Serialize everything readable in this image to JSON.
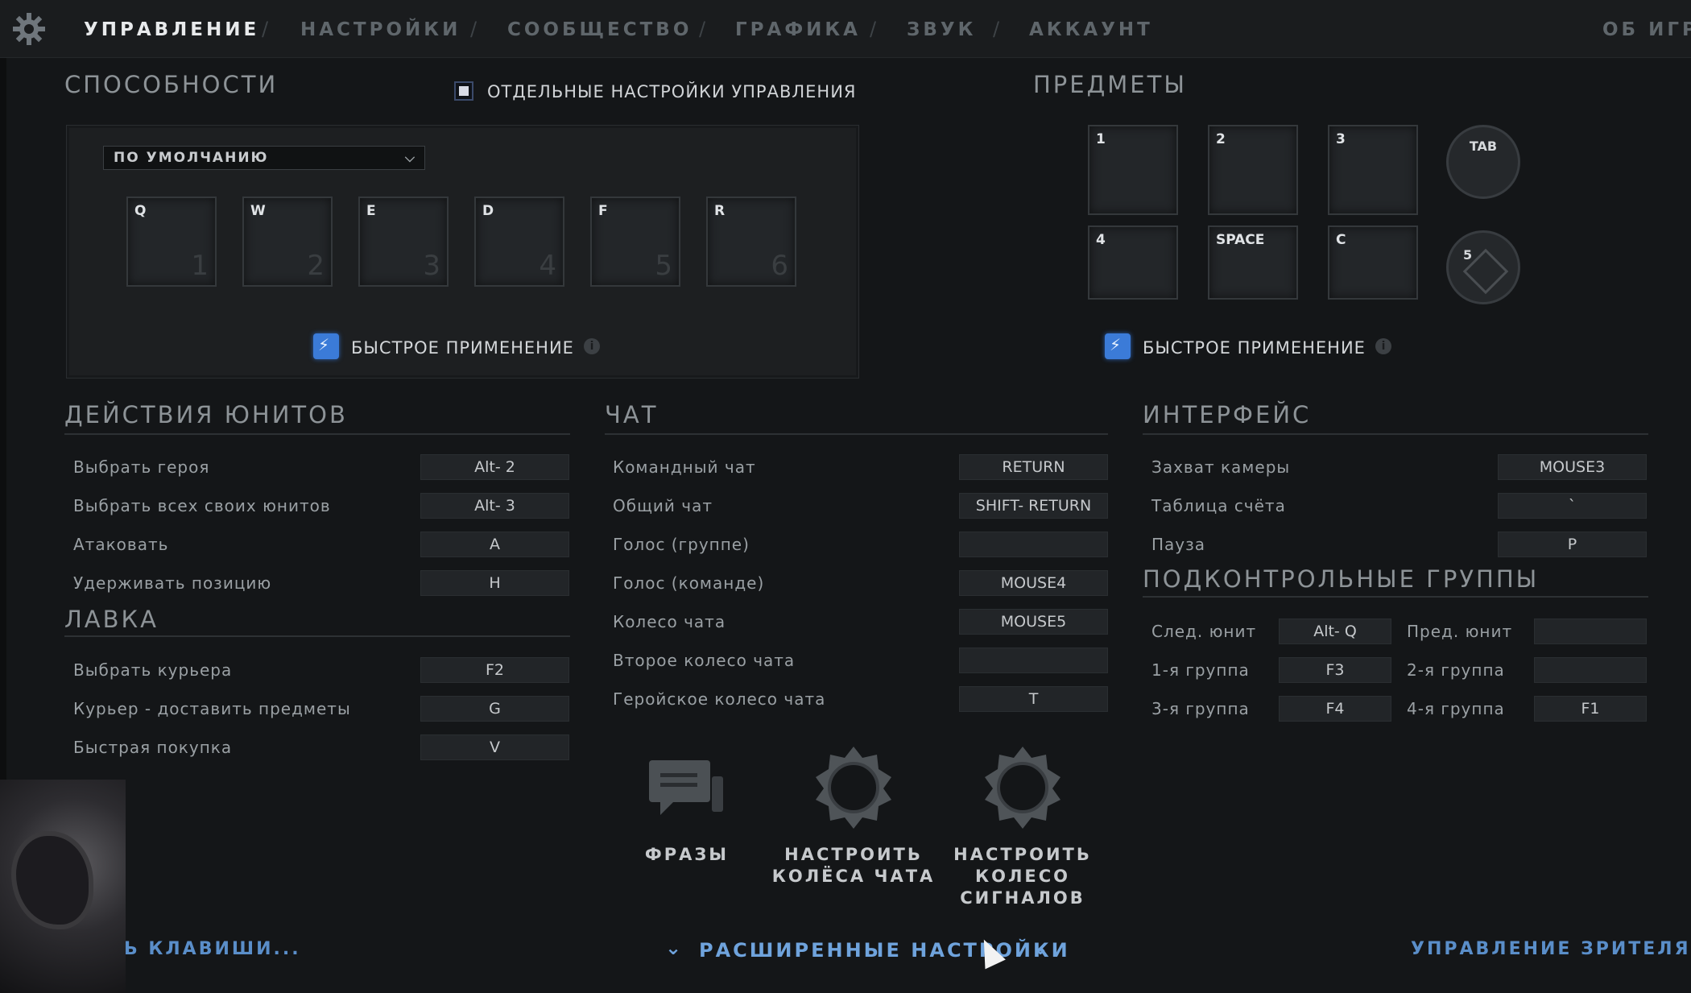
{
  "nav": {
    "tabs": [
      "УПРАВЛЕНИЕ",
      "НАСТРОЙКИ",
      "СООБЩЕСТВО",
      "ГРАФИКА",
      "ЗВУК",
      "АККАУНТ",
      "ОБ ИГРЕ"
    ],
    "separator": "/",
    "active_index": 0
  },
  "abilities": {
    "title": "СПОСОБНОСТИ",
    "custom_controls_label": "ОТДЕЛЬНЫЕ НАСТРОЙКИ УПРАВЛЕНИЯ",
    "preset": "ПО УМОЛЧАНИЮ",
    "slots": [
      {
        "key": "Q",
        "num": "1"
      },
      {
        "key": "W",
        "num": "2"
      },
      {
        "key": "E",
        "num": "3"
      },
      {
        "key": "D",
        "num": "4"
      },
      {
        "key": "F",
        "num": "5"
      },
      {
        "key": "R",
        "num": "6"
      }
    ],
    "quickcast_label": "БЫСТРОЕ ПРИМЕНЕНИЕ",
    "info_glyph": "i"
  },
  "items": {
    "title": "ПРЕДМЕТЫ",
    "slots": [
      "1",
      "2",
      "3",
      "4",
      "SPACE",
      "C"
    ],
    "round_slots": [
      "TAB",
      "5"
    ],
    "quickcast_label": "БЫСТРОЕ ПРИМЕНЕНИЕ"
  },
  "unit_actions": {
    "title": "ДЕЙСТВИЯ ЮНИТОВ",
    "rows": [
      {
        "label": "Выбрать героя",
        "key": "Alt- 2"
      },
      {
        "label": "Выбрать всех своих юнитов",
        "key": "Alt- 3"
      },
      {
        "label": "Атаковать",
        "key": "A"
      },
      {
        "label": "Удерживать позицию",
        "key": "H"
      }
    ]
  },
  "shop": {
    "title": "ЛАВКА",
    "rows": [
      {
        "label": "Выбрать курьера",
        "key": "F2"
      },
      {
        "label": "Курьер - доставить предметы",
        "key": "G"
      },
      {
        "label": "Быстрая покупка",
        "key": "V"
      }
    ]
  },
  "chat": {
    "title": "ЧАТ",
    "rows": [
      {
        "label": "Командный чат",
        "key": "RETURN"
      },
      {
        "label": "Общий чат",
        "key": "SHIFT- RETURN"
      },
      {
        "label": "Голос (группе)",
        "key": ""
      },
      {
        "label": "Голос (команде)",
        "key": "MOUSE4"
      },
      {
        "label": "Колесо чата",
        "key": "MOUSE5"
      },
      {
        "label": "Второе колесо чата",
        "key": ""
      },
      {
        "label": "Геройское колесо чата",
        "key": "T"
      }
    ],
    "buttons": [
      {
        "label": "ФРАЗЫ",
        "icon": "chat-bubbles-icon"
      },
      {
        "label": "НАСТРОИТЬ КОЛЁСА ЧАТА",
        "icon": "chat-wheel-icon"
      },
      {
        "label": "НАСТРОИТЬ КОЛЕСО СИГНАЛОВ",
        "icon": "ping-wheel-icon"
      }
    ]
  },
  "interface": {
    "title": "ИНТЕРФЕЙС",
    "rows": [
      {
        "label": "Захват камеры",
        "key": "MOUSE3"
      },
      {
        "label": "Таблица счёта",
        "key": "`"
      },
      {
        "label": "Пауза",
        "key": "P"
      }
    ]
  },
  "control_groups": {
    "title": "ПОДКОНТРОЛЬНЫЕ ГРУППЫ",
    "rows": [
      {
        "left_label": "След. юнит",
        "left_key": "Alt- Q",
        "right_label": "Пред. юнит",
        "right_key": ""
      },
      {
        "left_label": "1-я группа",
        "left_key": "F3",
        "right_label": "2-я группа",
        "right_key": ""
      },
      {
        "left_label": "3-я группа",
        "left_key": "F4",
        "right_label": "4-я группа",
        "right_key": "F1"
      }
    ]
  },
  "footer": {
    "left_link": "Ь КЛАВИШИ...",
    "advanced": "РАСШИРЕННЫЕ НАСТРОЙКИ",
    "advanced_chevron": "⌄",
    "right_link": "УПРАВЛЕНИЕ ЗРИТЕЛЯ »"
  }
}
